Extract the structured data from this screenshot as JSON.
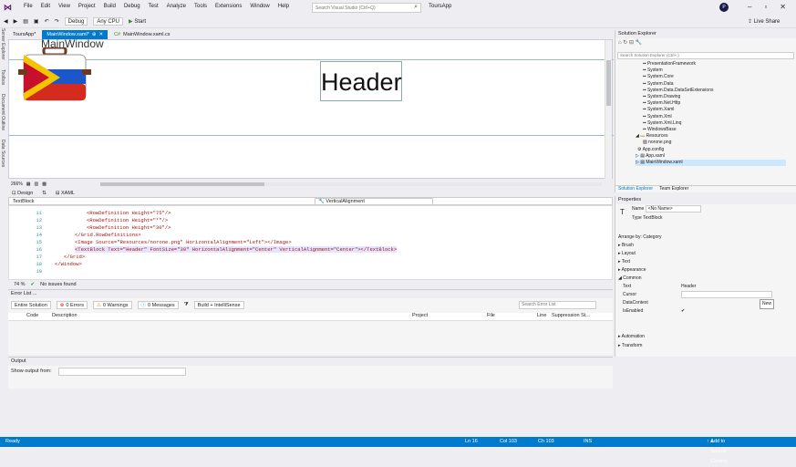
{
  "menu": {
    "items": [
      "File",
      "Edit",
      "View",
      "Project",
      "Build",
      "Debug",
      "Test",
      "Analyze",
      "Tools",
      "Extensions",
      "Window",
      "Help"
    ],
    "search_placeholder": "Search Visual Studio (Ctrl+Q)",
    "project": "ToursApp",
    "avatar": "P"
  },
  "toolbar": {
    "config": "Debug",
    "platform": "Any CPU",
    "start": "Start",
    "live_share": "Live Share"
  },
  "side_tabs": [
    "Server Explorer",
    "Toolbox",
    "Document Outline",
    "Data Sources"
  ],
  "tabs": [
    {
      "label": "ToursApp*"
    },
    {
      "label": "MainWindow.xaml*"
    },
    {
      "label": "MainWindow.xaml.cs"
    }
  ],
  "designer": {
    "title_fragment": "MainWindow",
    "header_text": "Header",
    "zoom": "266%"
  },
  "design_tabs": {
    "design": "Design",
    "xaml": "XAML"
  },
  "nav": {
    "left": "TextBlock",
    "right": "VerticalAlignment"
  },
  "code_lines": [
    {
      "n": "11",
      "text": "<RowDefinition Height=\"75\"/>"
    },
    {
      "n": "12",
      "text": "<RowDefinition Height=\"*\"/>"
    },
    {
      "n": "13",
      "text": "<RowDefinition Height=\"30\"/>"
    },
    {
      "n": "14",
      "text": "</Grid.RowDefinitions>"
    },
    {
      "n": "15",
      "text": "<Image Source=\"Resources/norone.png\" HorizontalAlignment=\"Left\"></Image>"
    },
    {
      "n": "16",
      "text": "<TextBlock Text=\"Header\" FontSize=\"30\" HorizontalAlignment=\"Center\" VerticalAlignment=\"Center\"></TextBlock>"
    },
    {
      "n": "17",
      "text": "</Grid>"
    },
    {
      "n": "18",
      "text": "</Window>"
    },
    {
      "n": "19",
      "text": ""
    }
  ],
  "editor_status": {
    "zoom": "74 %",
    "issues": "No issues found"
  },
  "error_list": {
    "title": "Error List ...",
    "scope": "Entire Solution",
    "errors": "0 Errors",
    "warnings": "0 Warnings",
    "messages": "0 Messages",
    "build": "Build + IntelliSense",
    "search": "Search Error List",
    "columns": [
      "Code",
      "Description",
      "Project",
      "File",
      "Line",
      "Suppression St..."
    ]
  },
  "output": {
    "title": "Output",
    "show_from": "Show output from:"
  },
  "solution_explorer": {
    "title": "Solution Explorer",
    "search": "Search Solution Explorer (Ctrl+;)",
    "items": [
      "PresentationFramework",
      "System",
      "System.Core",
      "System.Data",
      "System.Data.DataSetExtensions",
      "System.Drawing",
      "System.Net.Http",
      "System.Xaml",
      "System.Xml",
      "System.Xml.Linq",
      "WindowsBase",
      "Resources",
      "norone.png",
      "App.config",
      "App.xaml",
      "MainWindow.xaml"
    ],
    "tabs": [
      "Solution Explorer",
      "Team Explorer"
    ]
  },
  "properties": {
    "title": "Properties",
    "name_label": "Name",
    "name_value": "<No Name>",
    "type_label": "Type",
    "type_value": "TextBlock",
    "arrange": "Arrange by: Category",
    "groups": [
      "Brush",
      "Layout",
      "Text",
      "Appearance",
      "Common"
    ],
    "rows": [
      {
        "k": "Text",
        "v": "Header"
      },
      {
        "k": "Cursor",
        "v": ""
      },
      {
        "k": "DataContext",
        "v": "New"
      },
      {
        "k": "IsEnabled",
        "v": "✔"
      }
    ],
    "groups2": [
      "Automation",
      "Transform"
    ]
  },
  "statusbar": {
    "ready": "Ready",
    "ln": "Ln 16",
    "col": "Col 103",
    "ch": "Ch 103",
    "ins": "INS",
    "source": "Add to Source Control"
  }
}
